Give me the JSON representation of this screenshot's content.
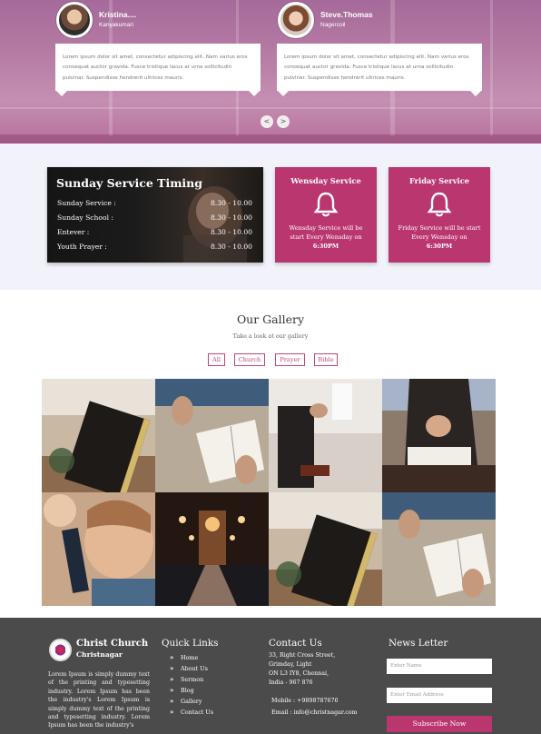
{
  "testimonials": [
    {
      "name": "Kristina....",
      "location": "Kanyakumari",
      "text": "Lorem ipsum dolor sit amet, consectetur adipiscing elit. Nam varius eros consequat auctor gravida. Fusce tristique lacus at urna sollicitudin pulvinar. Suspendisse hendrerit ultrices mauris."
    },
    {
      "name": "Steve.Thomas",
      "location": "Nagercoil",
      "text": "Lorem ipsum dolor sit amet, consectetur adipiscing elit. Nam varius eros consequat auctor gravida. Fusce tristique lacus at urna sollicitudin pulvinar. Suspendisse hendrerit ultrices mauris."
    }
  ],
  "slider": {
    "prev": "<",
    "next": ">"
  },
  "service_timing": {
    "title": "Sunday Service Timing",
    "rows": [
      {
        "label": "Sunday Service :",
        "time": "8.30 - 10.00"
      },
      {
        "label": "Sunday School :",
        "time": "8.30 - 10.00"
      },
      {
        "label": "Entever :",
        "time": "8.30 - 10.00"
      },
      {
        "label": "Youth Prayer :",
        "time": "8.30 - 10.00"
      }
    ]
  },
  "service_cards": [
    {
      "title": "Wensday Service",
      "desc": "Wensday Service will be start Every Wensday on",
      "time": "6:30PM"
    },
    {
      "title": "Friday Service",
      "desc": "Friday Service will be start Every Wensday on",
      "time": "6:30PM"
    }
  ],
  "gallery": {
    "title": "Our Gallery",
    "subtitle": "Take a look at our gallery",
    "filters": [
      "All",
      "Church",
      "Prayer",
      "Bible"
    ]
  },
  "footer": {
    "brand_name": "Christ Church",
    "brand_sub": "Christnagar",
    "about": "Lorem Ipsum is simply dummy text of the printing and typesetting industry. Lorem Ipsum has been the industry's Lorem Ipsum is simply dummy text of the printing and typesetting industry. Lorem Ipsum has been the industry's",
    "quick_links_title": "Quick Links",
    "quick_links": [
      "Home",
      "About Us",
      "Sermon",
      "Blog",
      "Gallery",
      "Contact Us"
    ],
    "contact_title": "Contact Us",
    "address1": "33, Right Cross Street,",
    "address2": "Grimday, Light",
    "address3": "ON L3 IY8, Chennai,",
    "address4": "India - 967 876",
    "mobile": "Mobile : +9898787676",
    "email": "Email : info@christnagar.com",
    "newsletter_title": "News Letter",
    "name_placeholder": "Enter Name",
    "email_placeholder": "Enter Email Address",
    "subscribe_label": "Subscribe Now"
  },
  "colors": {
    "accent": "#b9376e",
    "footer_bg": "#4b4b4b",
    "services_bg": "#f2f2fa"
  }
}
